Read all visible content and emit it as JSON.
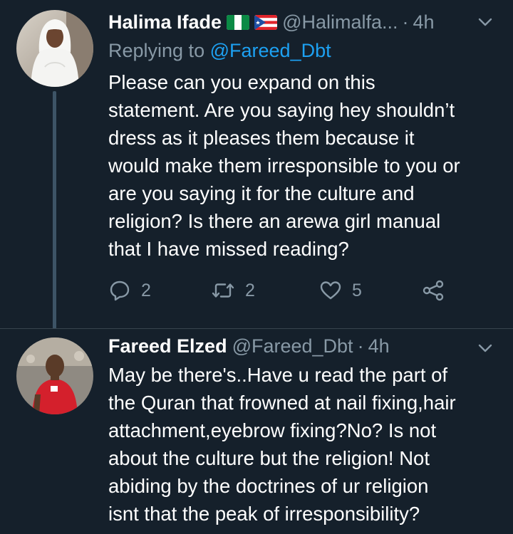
{
  "tweet1": {
    "display_name": "Halima Ifade",
    "handle": "@Halimalfa...",
    "separator": "·",
    "time": "4h",
    "replying_prefix": "Replying to",
    "replying_to": "@Fareed_Dbt",
    "text_lines": [
      "Please can you expand on this",
      "statement. Are you saying hey shouldn’t",
      "dress as it pleases them because it",
      "would make them irresponsible to you or",
      "are you saying it for the culture and",
      "religion? Is there an arewa girl manual",
      "that I have missed reading?"
    ],
    "reply_count": "2",
    "retweet_count": "2",
    "like_count": "5",
    "flags": [
      "nigeria-flag",
      "puerto-rico-flag"
    ]
  },
  "tweet2": {
    "display_name": "Fareed Elzed",
    "handle": "@Fareed_Dbt",
    "separator": "·",
    "time": "4h",
    "text_lines": [
      "May be there's..Have u read the part of",
      "the Quran that frowned at nail fixing,hair",
      "attachment,eyebrow fixing?No? Is not",
      "about the culture but the religion! Not",
      "abiding by the doctrines of ur religion",
      "isnt that the peak of irresponsibility?"
    ]
  },
  "icons": {
    "reply": "speech-bubble-icon",
    "retweet": "retweet-icon",
    "like": "heart-icon",
    "share": "share-icon",
    "menu": "chevron-down-icon"
  },
  "colors": {
    "background": "#15202b",
    "text": "#ffffff",
    "secondary": "#8899a6",
    "link": "#1da1f2",
    "thread_line": "#3d5466"
  }
}
